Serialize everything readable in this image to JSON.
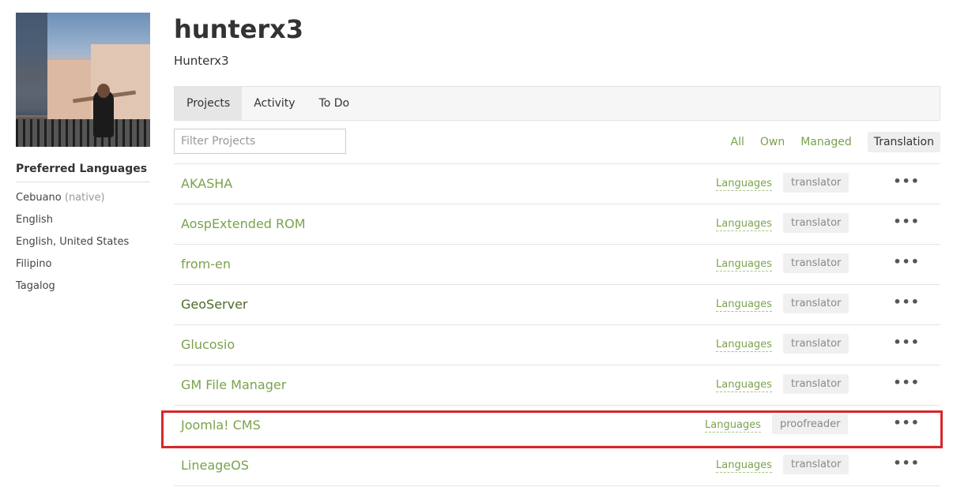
{
  "profile": {
    "username": "hunterx3",
    "fullname": "Hunterx3"
  },
  "sidebar": {
    "title": "Preferred Languages",
    "languages": [
      {
        "name": "Cebuano",
        "note": "(native)"
      },
      {
        "name": "English",
        "note": ""
      },
      {
        "name": "English, United States",
        "note": ""
      },
      {
        "name": "Filipino",
        "note": ""
      },
      {
        "name": "Tagalog",
        "note": ""
      }
    ]
  },
  "tabs": [
    {
      "label": "Projects",
      "active": true
    },
    {
      "label": "Activity",
      "active": false
    },
    {
      "label": "To Do",
      "active": false
    }
  ],
  "filter": {
    "placeholder": "Filter Projects",
    "options": [
      {
        "label": "All",
        "active": false
      },
      {
        "label": "Own",
        "active": false
      },
      {
        "label": "Managed",
        "active": false
      },
      {
        "label": "Translation",
        "active": true
      }
    ]
  },
  "projects": [
    {
      "name": "AKASHA",
      "languages_label": "Languages",
      "role": "translator",
      "more": "•••"
    },
    {
      "name": "AospExtended ROM",
      "languages_label": "Languages",
      "role": "translator",
      "more": "•••"
    },
    {
      "name": "from-en",
      "languages_label": "Languages",
      "role": "translator",
      "more": "•••"
    },
    {
      "name": "GeoServer",
      "languages_label": "Languages",
      "role": "translator",
      "more": "•••"
    },
    {
      "name": "Glucosio",
      "languages_label": "Languages",
      "role": "translator",
      "more": "•••"
    },
    {
      "name": "GM File Manager",
      "languages_label": "Languages",
      "role": "translator",
      "more": "•••"
    },
    {
      "name": "Joomla! CMS",
      "languages_label": "Languages",
      "role": "proofreader",
      "more": "•••"
    },
    {
      "name": "LineageOS",
      "languages_label": "Languages",
      "role": "translator",
      "more": "•••"
    }
  ],
  "colors": {
    "accent": "#7aa24c",
    "highlight": "#d7262d"
  }
}
